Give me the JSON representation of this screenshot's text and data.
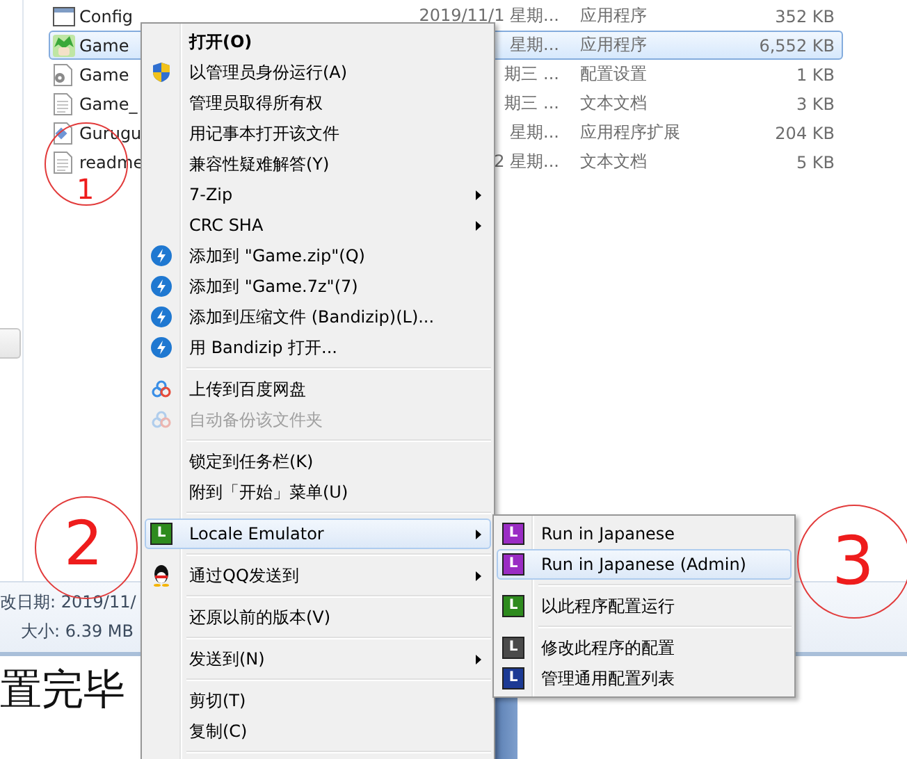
{
  "files": [
    {
      "kind": "window",
      "name": "Config",
      "date": "2019/11/1 星期...",
      "type": "应用程序",
      "size": "352 KB",
      "selected": false
    },
    {
      "kind": "app",
      "name": "Game",
      "date": "星期...",
      "type": "应用程序",
      "size": "6,552 KB",
      "selected": true
    },
    {
      "kind": "settings",
      "name": "Game",
      "date": "期三 ...",
      "type": "配置设置",
      "size": "1 KB",
      "selected": false
    },
    {
      "kind": "text",
      "name": "Game_",
      "date": "期三 ...",
      "type": "文本文档",
      "size": "3 KB",
      "selected": false
    },
    {
      "kind": "dll",
      "name": "Gurugu",
      "date": "星期...",
      "type": "应用程序扩展",
      "size": "204 KB",
      "selected": false
    },
    {
      "kind": "text",
      "name": "readme",
      "date": "2 星期...",
      "type": "文本文档",
      "size": "5 KB",
      "selected": false
    }
  ],
  "details": {
    "modified": "改日期: 2019/11/",
    "size": "大小: 6.39 MB"
  },
  "document_text": "置完毕",
  "annotations": [
    "1",
    "2",
    "3"
  ],
  "context_menu": {
    "items": [
      {
        "kind": "plain",
        "label": "打开(O)",
        "default": true,
        "selected": false
      },
      {
        "kind": "shield",
        "label": "以管理员身份运行(A)",
        "selected": false
      },
      {
        "kind": "plain",
        "label": "管理员取得所有权",
        "selected": false
      },
      {
        "kind": "plain",
        "label": "用记事本打开该文件",
        "selected": false
      },
      {
        "kind": "plain",
        "label": "兼容性疑难解答(Y)",
        "selected": false
      },
      {
        "kind": "plain",
        "label": "7-Zip",
        "submenu": true,
        "selected": false
      },
      {
        "kind": "plain",
        "label": "CRC SHA",
        "submenu": true,
        "selected": false
      },
      {
        "kind": "bandizip",
        "label": "添加到 \"Game.zip\"(Q)",
        "selected": false
      },
      {
        "kind": "bandizip",
        "label": "添加到 \"Game.7z\"(7)",
        "selected": false
      },
      {
        "kind": "bandizip",
        "label": "添加到压缩文件 (Bandizip)(L)...",
        "selected": false
      },
      {
        "kind": "bandizip",
        "label": "用 Bandizip 打开...",
        "selected": false
      },
      {
        "kind": "separator"
      },
      {
        "kind": "cloud",
        "label": "上传到百度网盘",
        "disabled": false,
        "selected": false
      },
      {
        "kind": "cloud",
        "label": "自动备份该文件夹",
        "disabled": true,
        "selected": false
      },
      {
        "kind": "separator"
      },
      {
        "kind": "plain",
        "label": "锁定到任务栏(K)",
        "selected": false
      },
      {
        "kind": "plain",
        "label": "附到「开始」菜单(U)",
        "selected": false
      },
      {
        "kind": "separator"
      },
      {
        "kind": "badge",
        "label": "Locale Emulator",
        "badge": "L",
        "color": "#2e8b1e",
        "submenu": true,
        "selected": true
      },
      {
        "kind": "separator"
      },
      {
        "kind": "penguin",
        "label": "通过QQ发送到",
        "submenu": true,
        "selected": false
      },
      {
        "kind": "separator"
      },
      {
        "kind": "plain",
        "label": "还原以前的版本(V)",
        "selected": false
      },
      {
        "kind": "separator"
      },
      {
        "kind": "plain",
        "label": "发送到(N)",
        "submenu": true,
        "selected": false
      },
      {
        "kind": "separator"
      },
      {
        "kind": "plain",
        "label": "剪切(T)",
        "selected": false
      },
      {
        "kind": "plain",
        "label": "复制(C)",
        "selected": false
      },
      {
        "kind": "separator"
      }
    ]
  },
  "submenu": {
    "items": [
      {
        "kind": "badge",
        "label": "Run in Japanese",
        "badge": "L",
        "color": "#9a2cc4",
        "selected": false
      },
      {
        "kind": "badge",
        "label": "Run in Japanese (Admin)",
        "badge": "L",
        "color": "#9a2cc4",
        "selected": true
      },
      {
        "kind": "separator"
      },
      {
        "kind": "badge",
        "label": "以此程序配置运行",
        "badge": "L",
        "color": "#2e8b1e",
        "selected": false
      },
      {
        "kind": "separator"
      },
      {
        "kind": "badge",
        "label": "修改此程序的配置",
        "badge": "L",
        "color": "#4a4a4a",
        "selected": false
      },
      {
        "kind": "badge",
        "label": "管理通用配置列表",
        "badge": "L",
        "color": "#1c3a94",
        "selected": false
      }
    ]
  }
}
